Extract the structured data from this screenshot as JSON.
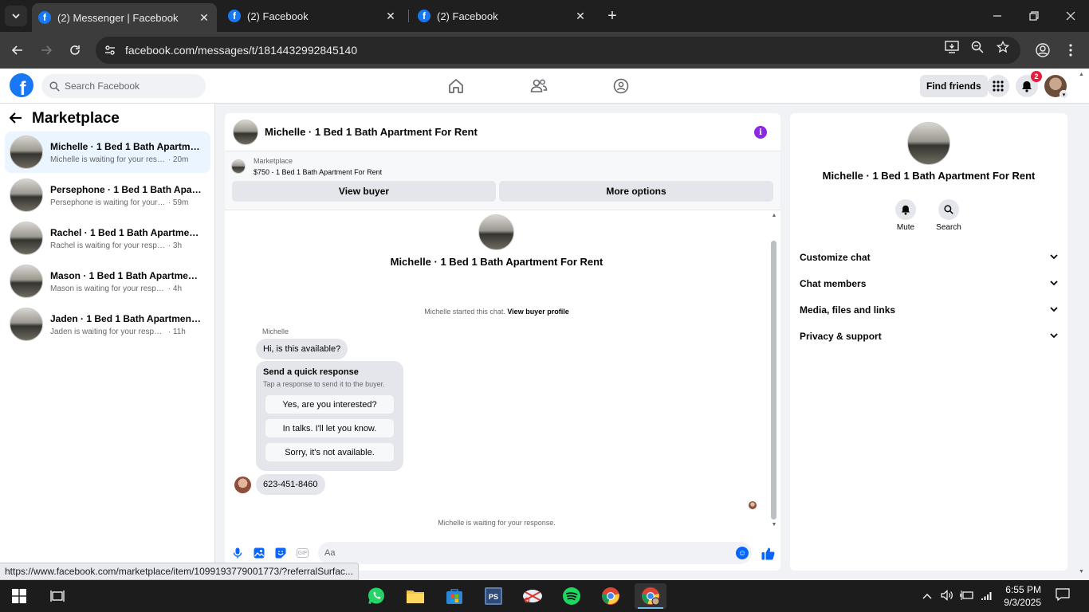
{
  "browser": {
    "tabs": [
      {
        "title": "(2) Messenger | Facebook",
        "active": true
      },
      {
        "title": "(2) Facebook",
        "active": false
      },
      {
        "title": "(2) Facebook",
        "active": false
      }
    ],
    "url": "facebook.com/messages/t/1814432992845140",
    "status_url": "https://www.facebook.com/marketplace/item/1099193779001773/?referralSurfac..."
  },
  "fb": {
    "search_placeholder": "Search Facebook",
    "find_friends": "Find friends",
    "notification_count": "2",
    "accent": "#1877f2"
  },
  "sidebar": {
    "title": "Marketplace",
    "conversations": [
      {
        "title": "Michelle · 1 Bed 1 Bath Apartment ...",
        "sub": "Michelle is waiting for your response.",
        "time": " · 20m",
        "active": true
      },
      {
        "title": "Persephone · 1 Bed 1 Bath Apartm...",
        "sub": "Persephone is waiting for your resp...",
        "time": " · 59m"
      },
      {
        "title": "Rachel · 1 Bed 1 Bath Apartment F...",
        "sub": "Rachel is waiting for your response.",
        "time": " · 3h"
      },
      {
        "title": "Mason · 1 Bed 1 Bath Apartment F...",
        "sub": "Mason is waiting for your response.",
        "time": " · 4h"
      },
      {
        "title": "Jaden · 1 Bed 1 Bath Apartment Fo...",
        "sub": "Jaden is waiting for your response.",
        "time": " · 11h"
      }
    ]
  },
  "chat": {
    "header_name": "Michelle · 1 Bed 1 Bath Apartment For Rent",
    "listing_label": "Marketplace",
    "listing_price": "$750 - 1 Bed 1 Bath Apartment For Rent",
    "view_buyer": "View buyer",
    "more_options": "More options",
    "center_name": "Michelle · 1 Bed 1 Bath Apartment For Rent",
    "started_text": "Michelle started this chat. ",
    "view_profile": "View buyer profile",
    "sender_name": "Michelle",
    "message1": "Hi, is this available?",
    "quick_title": "Send a quick response",
    "quick_sub": "Tap a response to send it to the buyer.",
    "quick_options": [
      "Yes, are you interested?",
      "In talks. I'll let you know.",
      "Sorry, it's not available."
    ],
    "message2": "623-451-8460",
    "waiting": "Michelle is waiting for your response.",
    "input_placeholder": "Aa",
    "gif_label": "GIF"
  },
  "info": {
    "name": "Michelle · 1 Bed 1 Bath Apartment For Rent",
    "mute": "Mute",
    "search": "Search",
    "sections": [
      "Customize chat",
      "Chat members",
      "Media, files and links",
      "Privacy & support"
    ]
  },
  "taskbar": {
    "time": "6:55 PM",
    "date": "9/3/2025",
    "apps": [
      "windows-start",
      "task-view",
      "whatsapp",
      "file-explorer",
      "microsoft-store",
      "photoshop",
      "snipping-tool",
      "spotify",
      "chrome",
      "chrome-profile"
    ]
  }
}
